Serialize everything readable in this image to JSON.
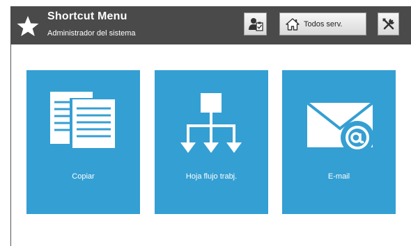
{
  "header": {
    "title": "Shortcut Menu",
    "subtitle": "Administrador del sistema",
    "star_icon": "star-icon",
    "user_button_icon": "user-clipboard-icon",
    "home_button": {
      "icon": "home-icon",
      "label": "Todos serv."
    },
    "tools_button_icon": "tools-icon"
  },
  "tiles": [
    {
      "label": "Copiar",
      "icon": "copy-documents-icon"
    },
    {
      "label": "Hoja flujo trabj.",
      "icon": "workflow-icon"
    },
    {
      "label": "E-mail",
      "icon": "email-icon"
    }
  ],
  "colors": {
    "header_bg": "#4a4a4a",
    "tile_bg": "#349fd3",
    "tile_fg": "#ffffff"
  }
}
